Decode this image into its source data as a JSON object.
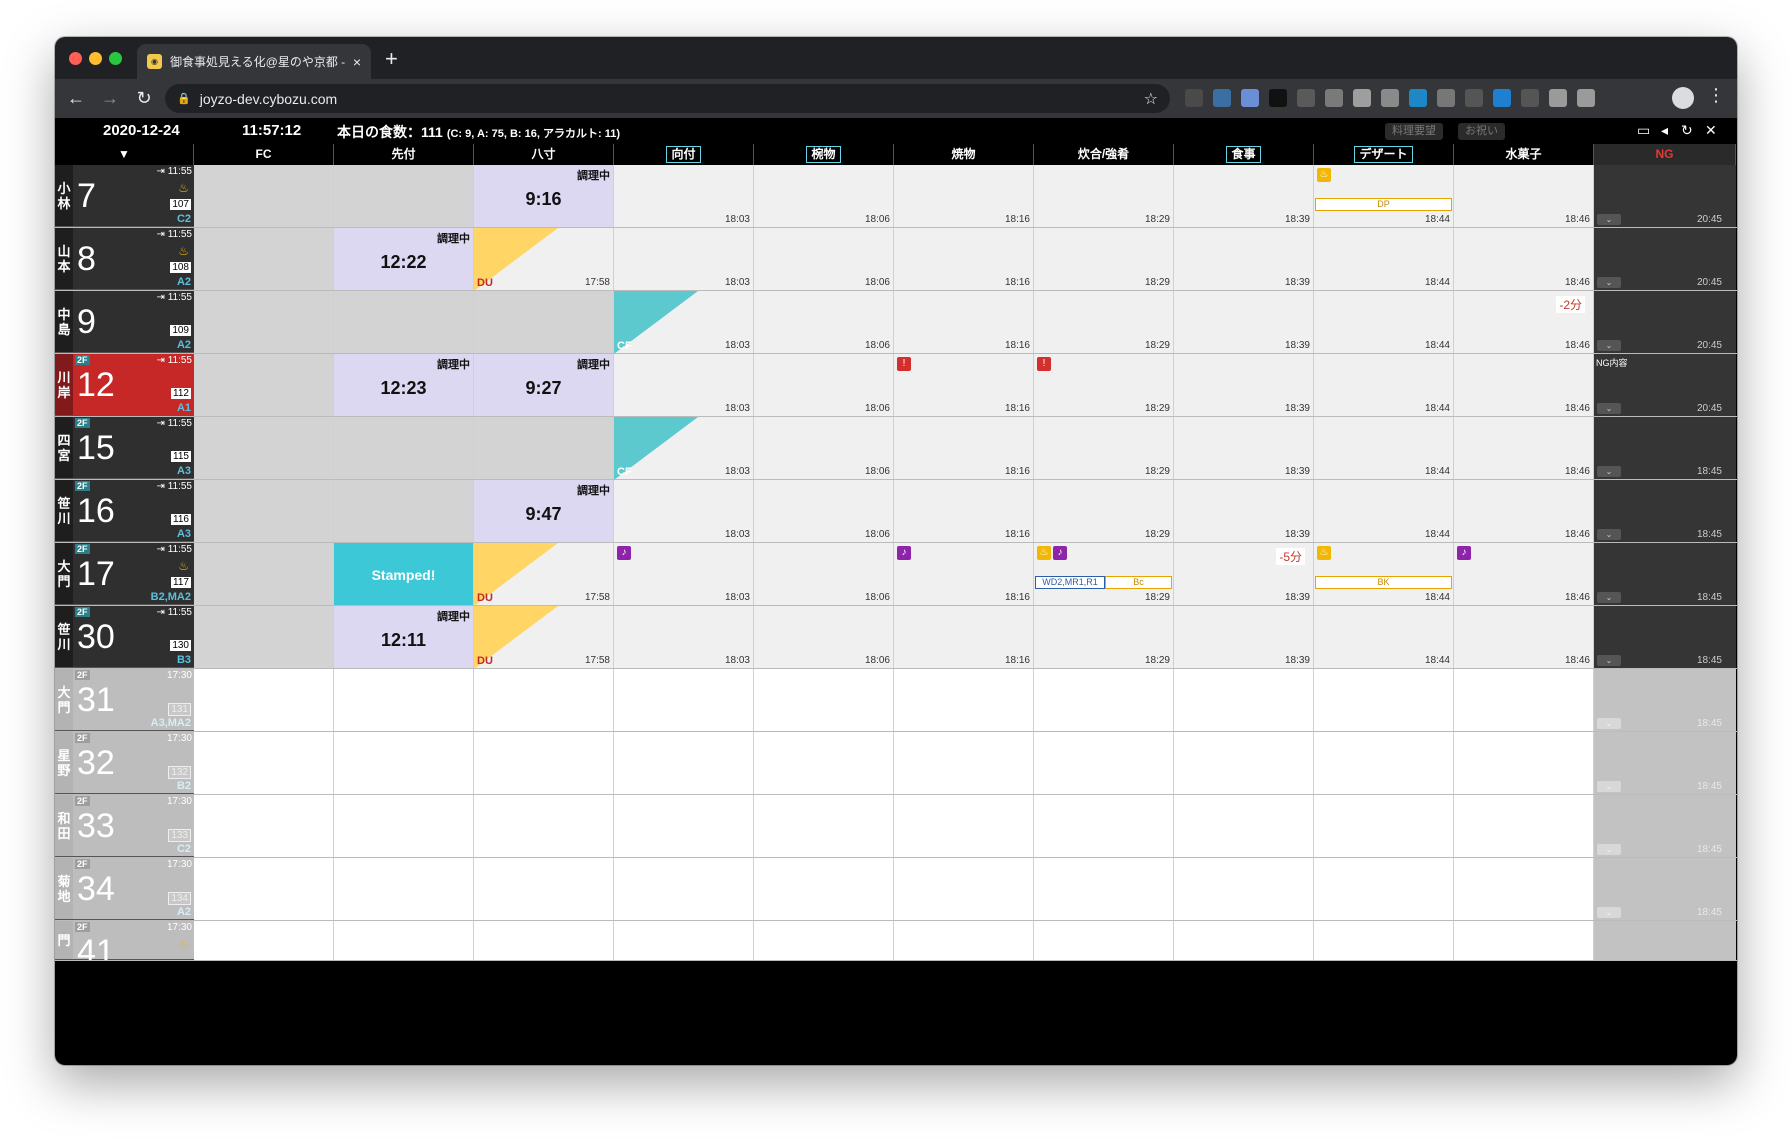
{
  "browser": {
    "tab_title": "御食事処見える化@星のや京都 - ",
    "tab_close": "×",
    "new_tab": "+",
    "url": "joyzo-dev.cybozu.com"
  },
  "app": {
    "date": "2020-12-24",
    "clock": "11:57:12",
    "meals_label": "本日の食数：111",
    "meals_detail": "(C: 9, A: 75, B: 16, アラカルト: 11)",
    "pill_request": "料理要望",
    "pill_celebration": "お祝い"
  },
  "columns": [
    "FC",
    "先付",
    "八寸",
    "向付",
    "椀物",
    "焼物",
    "炊合/強肴",
    "食事",
    "デザート",
    "水菓子",
    "NG"
  ],
  "labels": {
    "cooking": "調理中",
    "stamped": "Stamped!",
    "du": "DU",
    "cf": "CF",
    "dp": "DP",
    "bk": "BK",
    "bc": "Bc",
    "wd": "WD2,MR1,R1",
    "ng_content": "NG内容",
    "delay_2": "-2分",
    "delay_5": "-5分"
  },
  "rooms": [
    {
      "name1": "小",
      "name2": "林",
      "floor": "",
      "num": "7",
      "time": "11:55",
      "code": "107",
      "plan": "C2"
    },
    {
      "name1": "山",
      "name2": "本",
      "floor": "",
      "num": "8",
      "time": "11:55",
      "code": "108",
      "plan": "A2"
    },
    {
      "name1": "中",
      "name2": "島",
      "floor": "",
      "num": "9",
      "time": "11:55",
      "code": "109",
      "plan": "A2"
    },
    {
      "name1": "川",
      "name2": "岸",
      "floor": "2F",
      "num": "12",
      "time": "11:55",
      "code": "112",
      "plan": "A1"
    },
    {
      "name1": "四",
      "name2": "宮",
      "floor": "2F",
      "num": "15",
      "time": "11:55",
      "code": "115",
      "plan": "A3"
    },
    {
      "name1": "笹",
      "name2": "川",
      "floor": "2F",
      "num": "16",
      "time": "11:55",
      "code": "116",
      "plan": "A3"
    },
    {
      "name1": "大",
      "name2": "門",
      "floor": "2F",
      "num": "17",
      "time": "11:55",
      "code": "117",
      "plan": "B2,MA2"
    },
    {
      "name1": "笹",
      "name2": "川",
      "floor": "2F",
      "num": "30",
      "time": "11:55",
      "code": "130",
      "plan": "B3"
    },
    {
      "name1": "大",
      "name2": "門",
      "floor": "2F",
      "num": "31",
      "time": "17:30",
      "code": "131",
      "plan": "A3,MA2"
    },
    {
      "name1": "星",
      "name2": "野",
      "floor": "2F",
      "num": "32",
      "time": "17:30",
      "code": "132",
      "plan": "B2"
    },
    {
      "name1": "和",
      "name2": "田",
      "floor": "2F",
      "num": "33",
      "time": "17:30",
      "code": "133",
      "plan": "C2"
    },
    {
      "name1": "菊",
      "name2": "地",
      "floor": "2F",
      "num": "34",
      "time": "17:30",
      "code": "134",
      "plan": "A2"
    }
  ],
  "times": {
    "hassun": "17:58",
    "mukou": "18:03",
    "wan": "18:06",
    "yaki": "18:16",
    "taki": "18:29",
    "shokuji": "18:39",
    "dessert": "18:44",
    "mizu": "18:46",
    "ng_a": "20:45",
    "ng_b": "18:45"
  },
  "big_times": {
    "r7_hassun": "9:16",
    "r8_sakizuke": "12:22",
    "r12_sakizuke": "12:23",
    "r12_hassun": "9:27",
    "r16_hassun": "9:47",
    "r30_sakizuke": "12:11"
  },
  "partial_row": {
    "floor": "2F",
    "time": "17:30",
    "num": "41",
    "name1": "門"
  },
  "colors": {
    "accent_cyan": "#3cc8d6",
    "cooking_lavender": "#dcd8f2",
    "du_yellow": "#ffd666",
    "alert_red": "#c62828",
    "purple": "#8e24aa"
  }
}
